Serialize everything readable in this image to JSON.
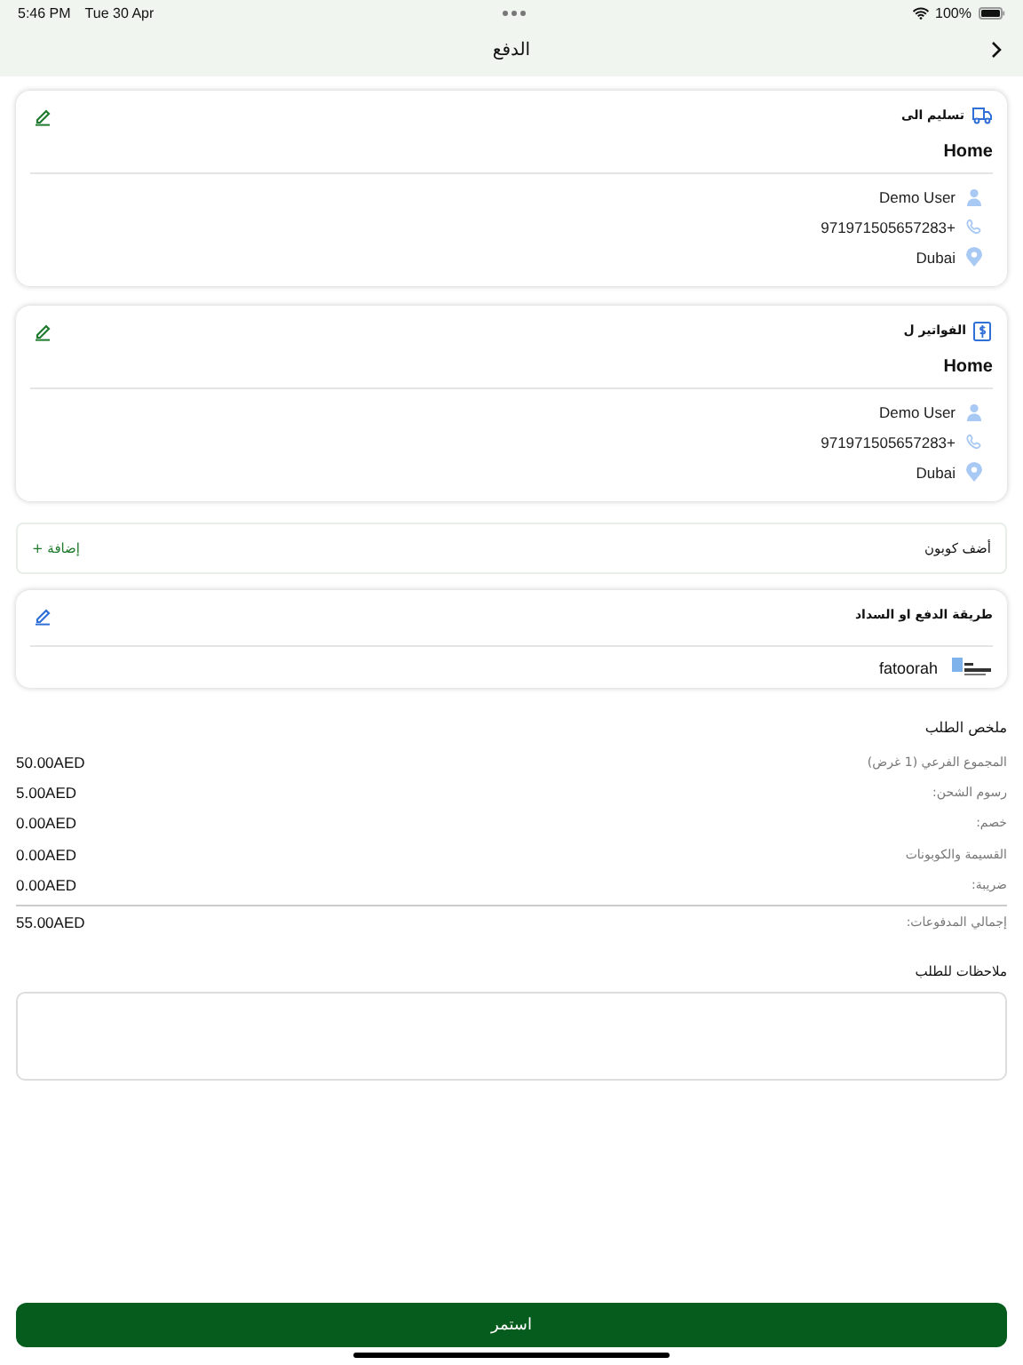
{
  "status_bar": {
    "time": "5:46 PM",
    "date": "Tue 30 Apr",
    "battery": "100%"
  },
  "nav": {
    "title": "الدفع"
  },
  "address_cards": [
    {
      "kind": "shipping",
      "title": "تسليم الى",
      "name": "Home",
      "contact": "Demo User",
      "phone": "971971505657283+",
      "city": "Dubai"
    },
    {
      "kind": "billing",
      "title": "الفواتير ل",
      "name": "Home",
      "contact": "Demo User",
      "phone": "971971505657283+",
      "city": "Dubai"
    }
  ],
  "coupon": {
    "label": "أضف كوبون",
    "action": "إضافة +"
  },
  "payment": {
    "title": "طريقة الدفع او السداد",
    "method": "fatoorah"
  },
  "summary": {
    "title": "ملخص الطلب",
    "rows": [
      {
        "label": "المجموع الفرعي (1 غرض)",
        "value": "50.00AED"
      },
      {
        "label": "رسوم الشحن:",
        "value": "5.00AED"
      },
      {
        "label": "خصم:",
        "value": "0.00AED"
      },
      {
        "label": "القسيمة والكوبونات",
        "value": "0.00AED"
      },
      {
        "label": "ضريبة:",
        "value": "0.00AED"
      }
    ],
    "total": {
      "label": "إجمالي المدفوعات:",
      "value": "55.00AED"
    }
  },
  "notes": {
    "label": "ملاحظات للطلب"
  },
  "continue_button": "استمر"
}
